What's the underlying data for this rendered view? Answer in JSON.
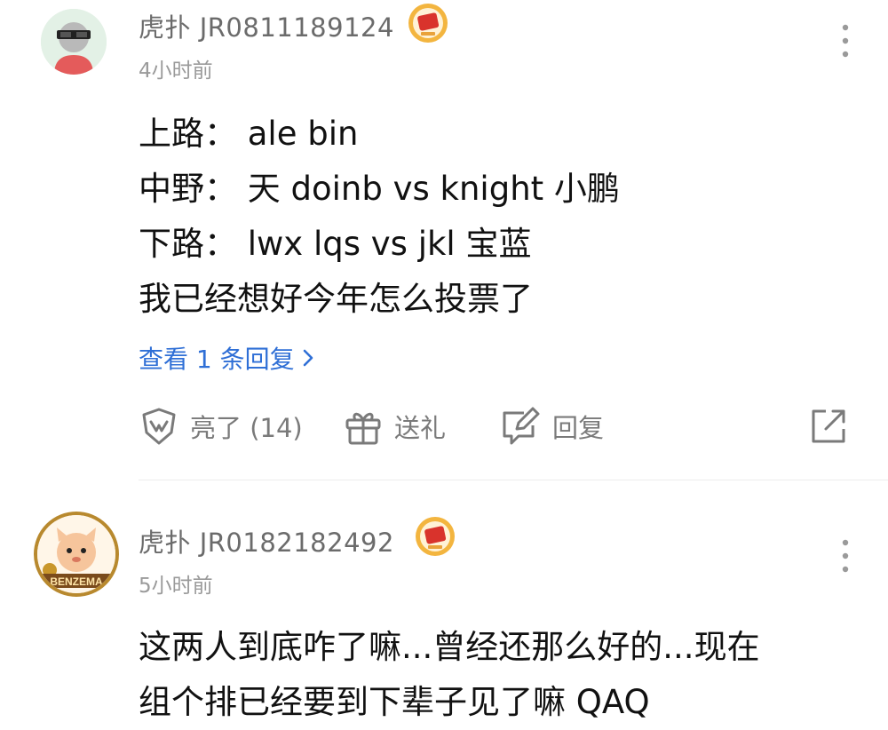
{
  "comments": [
    {
      "username": "虎扑 JR0811189124",
      "time": "4小时前",
      "lines": [
        "上路：  ale    bin",
        "中野：  天 doinb  vs knight 小鹏",
        "下路：  lwx lqs vs jkl 宝蓝",
        "我已经想好今年怎么投票了"
      ],
      "view_replies": "查看 1 条回复",
      "actions": {
        "like_label": "亮了 (14)",
        "gift_label": "送礼",
        "reply_label": "回复"
      }
    },
    {
      "username": "虎扑 JR0182182492",
      "time": "5小时前",
      "avatar_text": "BENZEMA",
      "lines": [
        "这两人到底咋了嘛...曾经还那么好的...现在",
        "组个排已经要到下辈子见了嘛 QAQ"
      ]
    }
  ],
  "icons": {
    "more": "more-vertical-icon",
    "like": "like-shield-icon",
    "gift": "gift-icon",
    "reply": "reply-edit-icon",
    "share": "share-icon",
    "badge": "level-badge-icon",
    "chevron": "chevron-right-icon"
  },
  "colors": {
    "link": "#2f6fd6",
    "meta": "#9a9a9a",
    "username": "#6b6b6b"
  }
}
